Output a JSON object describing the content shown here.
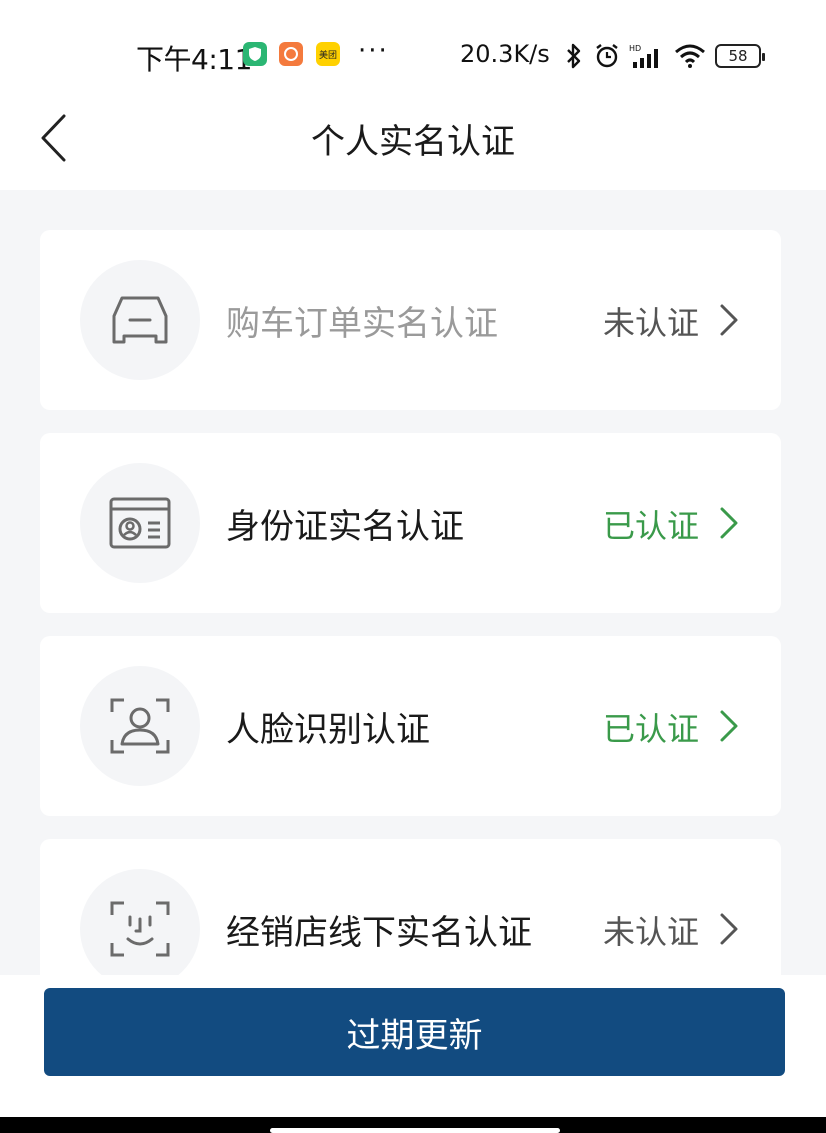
{
  "status_bar": {
    "time": "下午4:11",
    "apps": [
      "shield-app",
      "taobao-app",
      "美团"
    ],
    "more": "···",
    "net_speed": "20.3K/s",
    "battery": "58"
  },
  "nav": {
    "title": "个人实名认证"
  },
  "items": [
    {
      "label": "购车订单实名认证",
      "status": "未认证",
      "verified": false,
      "icon": "car-icon"
    },
    {
      "label": "身份证实名认证",
      "status": "已认证",
      "verified": true,
      "icon": "id-card-icon"
    },
    {
      "label": "人脸识别认证",
      "status": "已认证",
      "verified": true,
      "icon": "face-scan-icon"
    },
    {
      "label": "经销店线下实名认证",
      "status": "未认证",
      "verified": false,
      "icon": "face-smile-icon"
    }
  ],
  "button": {
    "label": "过期更新"
  },
  "colors": {
    "verified": "#3a9a4a",
    "primary": "#124b80",
    "background": "#f5f6f8"
  }
}
